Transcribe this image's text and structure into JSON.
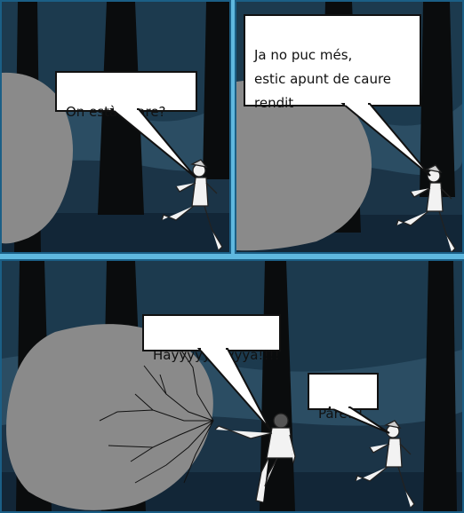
{
  "colors": {
    "page_border": "#5fb8df",
    "panel_frame": "#1b5f86",
    "sky": "#1c3a4e",
    "hill": "#2b4d63",
    "ground": "#122637",
    "tree": "#0a0c0d",
    "boulder": "#8a8a8a",
    "bubble_fill": "#ffffff"
  },
  "panels": [
    {
      "id": "panel-1",
      "speech": [
        {
          "speaker": "runner",
          "text": "On estàs pare?"
        }
      ]
    },
    {
      "id": "panel-2",
      "speech": [
        {
          "speaker": "runner",
          "text": "Ja no puc més,\nestic apunt de caure\nrendit"
        }
      ]
    },
    {
      "id": "panel-3",
      "speech": [
        {
          "speaker": "father",
          "text": "Hayyyyyyyyyya!!!!"
        },
        {
          "speaker": "runner",
          "text": "Pare!!!"
        }
      ]
    }
  ]
}
